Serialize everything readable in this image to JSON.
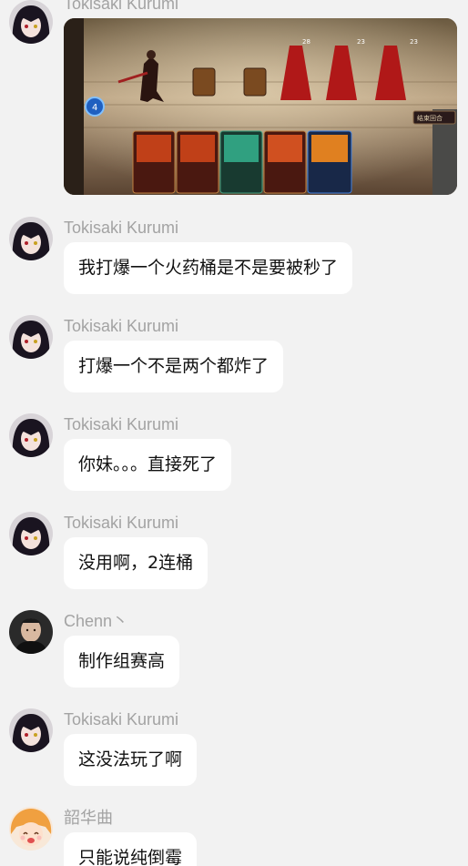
{
  "messages": [
    {
      "sender": "Tokisaki Kurumi",
      "type": "image",
      "image_alt": "game-screenshot"
    },
    {
      "sender": "Tokisaki Kurumi",
      "text": "我打爆一个火药桶是不是要被秒了"
    },
    {
      "sender": "Tokisaki Kurumi",
      "text": "打爆一个不是两个都炸了"
    },
    {
      "sender": "Tokisaki Kurumi",
      "text": "你妹。。。直接死了"
    },
    {
      "sender": "Tokisaki Kurumi",
      "text": "没用啊，2连桶"
    },
    {
      "sender": "Chenn丶",
      "text": "制作组赛高"
    },
    {
      "sender": "Tokisaki Kurumi",
      "text": "这没法玩了啊"
    },
    {
      "sender": "韶华曲",
      "text": "只能说纯倒霉"
    }
  ],
  "game_screenshot": {
    "enemy_hp": [
      "28",
      "23",
      "23"
    ],
    "energy": "4",
    "button_label": "结束回合"
  },
  "colors": {
    "background": "#f2f2f2",
    "bubble": "#ffffff",
    "sender_name": "#a3a3a3",
    "text": "#111111"
  }
}
